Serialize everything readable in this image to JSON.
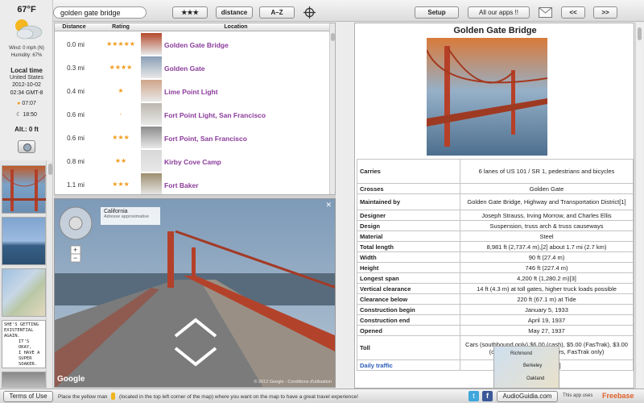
{
  "toolbar": {
    "search_value": "golden gate bridge",
    "rating_sort": "★★★",
    "distance_sort": "distance",
    "az_sort": "A–Z",
    "setup": "Setup",
    "all_apps": "All our apps !!",
    "prev": "<<",
    "next": ">>"
  },
  "weather": {
    "temp": "67°F",
    "wind": "Wind: 0 mph (N)",
    "humidity": "Humidity: 67%",
    "local_time_label": "Local time",
    "country": "United States",
    "date": "2012-10-02",
    "time": "02:34 GMT-8",
    "sunrise": "07:07",
    "sunset": "18:50",
    "altitude": "Alt.: 0 ft"
  },
  "table": {
    "headers": [
      "Distance",
      "Rating",
      "Location"
    ],
    "rows": [
      {
        "distance": "0.0 mi",
        "rating": "★★★★★",
        "location": "Golden Gate Bridge"
      },
      {
        "distance": "0.3 mi",
        "rating": "★★★★",
        "location": "Golden Gate"
      },
      {
        "distance": "0.4 mi",
        "rating": "★",
        "location": "Lime Point Light"
      },
      {
        "distance": "0.6 mi",
        "rating": "-",
        "location": "Fort Point Light, San Francisco"
      },
      {
        "distance": "0.6 mi",
        "rating": "★★★",
        "location": "Fort Point, San Francisco"
      },
      {
        "distance": "0.8 mi",
        "rating": "★★",
        "location": "Kirby Cove Camp"
      },
      {
        "distance": "1.1 mi",
        "rating": "★★★",
        "location": "Fort Baker"
      }
    ]
  },
  "streetview": {
    "place": "California",
    "subtitle": "Adresse approximative",
    "brand": "Google",
    "copyright": "© 2012 Google - Conditions d'utilisation"
  },
  "wiki": {
    "title": "Golden Gate Bridge",
    "rows": [
      {
        "k": "Carries",
        "v": "6 lanes of US 101 / SR 1, pedestrians and bicycles"
      },
      {
        "k": "Crosses",
        "v": "Golden Gate"
      },
      {
        "k": "Maintained by",
        "v": "Golden Gate Bridge, Highway and Transportation District[1]"
      },
      {
        "k": "Designer",
        "v": "Joseph Strauss, Irving Morrow, and Charles Ellis"
      },
      {
        "k": "Design",
        "v": "Suspension, truss arch & truss causeways"
      },
      {
        "k": "Material",
        "v": "Steel"
      },
      {
        "k": "Total length",
        "v": "8,981 ft (2,737.4 m),[2] about 1.7 mi (2.7 km)"
      },
      {
        "k": "Width",
        "v": "90 ft (27.4 m)"
      },
      {
        "k": "Height",
        "v": "746 ft (227.4 m)"
      },
      {
        "k": "Longest span",
        "v": "4,200 ft (1,280.2 m)[3]"
      },
      {
        "k": "Vertical clearance",
        "v": "14 ft (4.3 m) at toll gates, higher truck loads possible"
      },
      {
        "k": "Clearance below",
        "v": "220 ft (67.1 m) at Tide"
      },
      {
        "k": "Construction begin",
        "v": "January 5, 1933"
      },
      {
        "k": "Construction end",
        "v": "April 19, 1937"
      },
      {
        "k": "Opened",
        "v": "May 27, 1937"
      },
      {
        "k": "Toll",
        "v": "Cars (southbound only) $6.00 (cash), $5.00 (FasTrak), $3.00 (carpools during peak hours, FasTrak only)"
      },
      {
        "k": "Daily traffic",
        "v": "120,000[4]"
      }
    ],
    "map_labels": [
      "Richmond",
      "Berkeley",
      "Oakland"
    ]
  },
  "bottom": {
    "terms": "Terms of Use",
    "hint_pre": "Place the yellow man",
    "hint_post": "(located in the top left corner of the map) where you want on the map to have a great travel experience!",
    "site": "AudioGuidia.com",
    "uses": "This app uses",
    "freebase": "Freebase"
  },
  "comic_text": [
    "SHE'S GETTING",
    "EXISTENTIAL AGAIN.",
    "IT'S OKAY,",
    "I HAVE A",
    "SUPER SOAKER."
  ]
}
